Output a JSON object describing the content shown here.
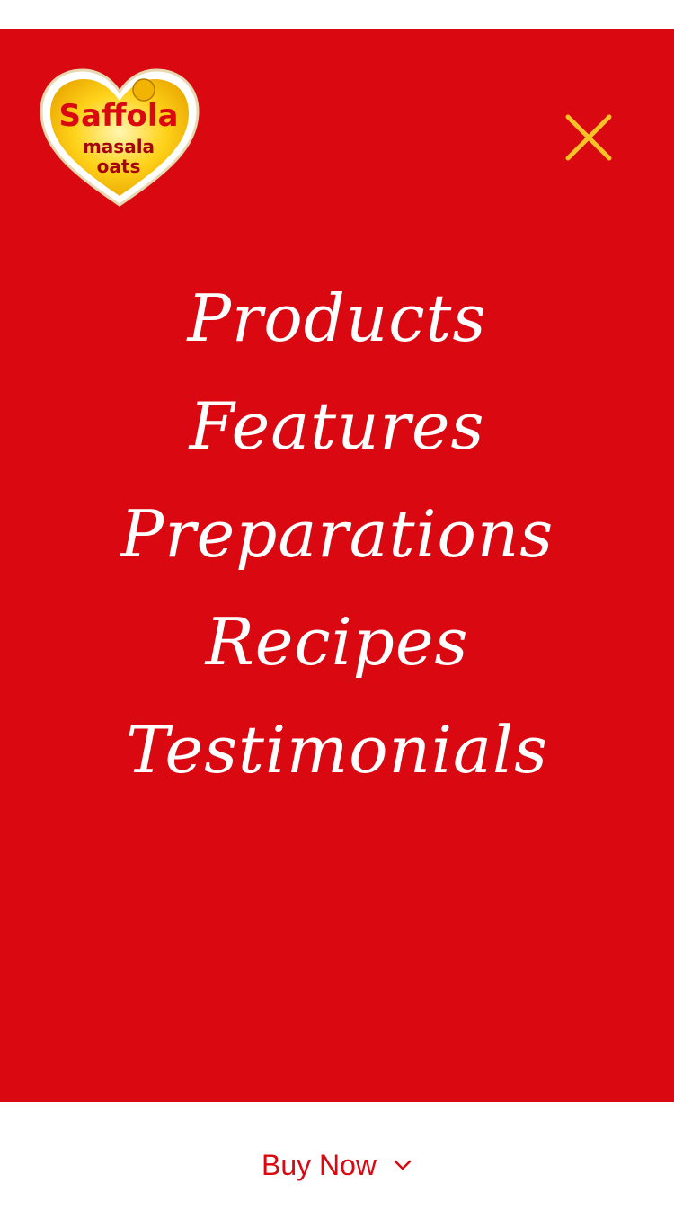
{
  "logo": {
    "brand": "Saffola",
    "line1": "masala",
    "line2": "oats"
  },
  "nav": {
    "items": [
      {
        "label": "Products"
      },
      {
        "label": "Features"
      },
      {
        "label": "Preparations"
      },
      {
        "label": "Recipes"
      },
      {
        "label": "Testimonials"
      }
    ]
  },
  "footer": {
    "buy_now_label": "Buy Now"
  },
  "icons": {
    "close": "close-icon",
    "chevron": "chevron-down-icon"
  },
  "colors": {
    "panel_bg": "#d90811",
    "accent_yellow": "#f7c326",
    "text_white": "#ffffff",
    "buy_now_red": "#d90811"
  }
}
